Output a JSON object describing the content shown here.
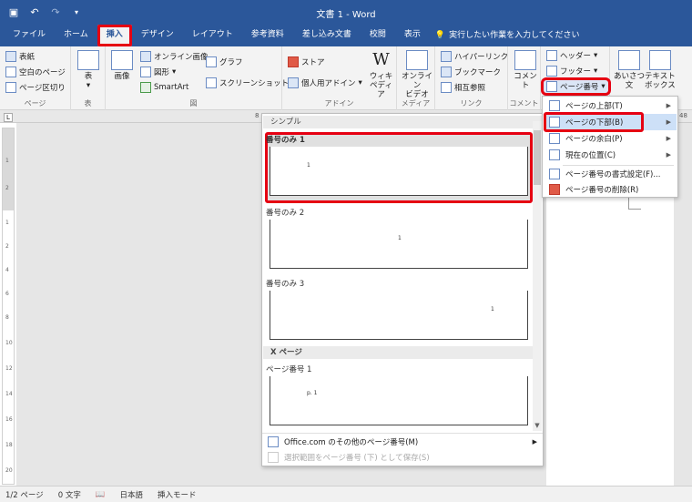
{
  "window": {
    "title": "文書 1 - Word"
  },
  "qat": {
    "save_icon": "save-icon",
    "undo_icon": "undo-icon",
    "redo_icon": "redo-icon",
    "customize_icon": "customize-qat-icon"
  },
  "tabs": [
    {
      "label": "ファイル"
    },
    {
      "label": "ホーム"
    },
    {
      "label": "挿入"
    },
    {
      "label": "デザイン"
    },
    {
      "label": "レイアウト"
    },
    {
      "label": "参考資料"
    },
    {
      "label": "差し込み文書"
    },
    {
      "label": "校閲"
    },
    {
      "label": "表示"
    }
  ],
  "tell_me": "実行したい作業を入力してください",
  "ribbon": {
    "pages": {
      "cover": "表紙",
      "blank": "空白のページ",
      "break": "ページ区切り",
      "label": "ページ"
    },
    "table": {
      "button": "表",
      "label": "表"
    },
    "illustrations": {
      "picture": "画像",
      "online_picture": "オンライン画像",
      "shapes": "図形",
      "smartart": "SmartArt",
      "chart": "グラフ",
      "screenshot": "スクリーンショット",
      "label": "図"
    },
    "addins": {
      "store": "ストア",
      "my_addins": "個人用アドイン",
      "wiki_line1": "ウィキ",
      "wiki_line2": "ペディア",
      "label": "アドイン"
    },
    "media": {
      "online_video_line1": "オンライン",
      "online_video_line2": "ビデオ",
      "label": "メディア"
    },
    "links": {
      "hyperlink": "ハイパーリンク",
      "bookmark": "ブックマーク",
      "cross_reference": "相互参照",
      "label": "リンク"
    },
    "comments": {
      "comment": "コメント",
      "label": "コメント"
    },
    "header_footer": {
      "header": "ヘッダー",
      "footer": "フッター",
      "page_number": "ページ番号"
    },
    "text": {
      "greeting_line1": "あいさつ",
      "greeting_line2": "文",
      "textbox_line1": "テキスト",
      "textbox_line2": "ボックス"
    }
  },
  "ruler": {
    "h_marker_left": "8",
    "h_marker_right": "48",
    "v_ticks": [
      "1",
      "2",
      "1",
      "2",
      "4",
      "6",
      "8",
      "10",
      "12",
      "14",
      "16",
      "18",
      "20"
    ]
  },
  "gallery": {
    "section_simple": "シンプル",
    "items": [
      {
        "label": "番号のみ 1",
        "number": "1"
      },
      {
        "label": "番号のみ 2",
        "number": "1"
      },
      {
        "label": "番号のみ 3",
        "number": "1"
      }
    ],
    "section_x_page": "X ページ",
    "page_number_item": {
      "label": "ページ番号 1",
      "number": "p. 1"
    },
    "more_online": "Office.com のその他のページ番号(M)",
    "save_selection": "選択範囲をページ番号 (下) として保存(S)"
  },
  "submenu": {
    "items": [
      {
        "label": "ページの上部(T)"
      },
      {
        "label": "ページの下部(B)"
      },
      {
        "label": "ページの余白(P)"
      },
      {
        "label": "現在の位置(C)"
      },
      {
        "label": "ページ番号の書式設定(F)..."
      },
      {
        "label": "ページ番号の削除(R)"
      }
    ]
  },
  "statusbar": {
    "page": "1/2 ページ",
    "words": "0 文字",
    "language": "日本語",
    "mode": "挿入モード"
  },
  "colors": {
    "accent": "#2b579a",
    "highlight": "#e60012",
    "ribbon_bg": "#f3f3f3",
    "canvas": "#e6e6e6"
  }
}
